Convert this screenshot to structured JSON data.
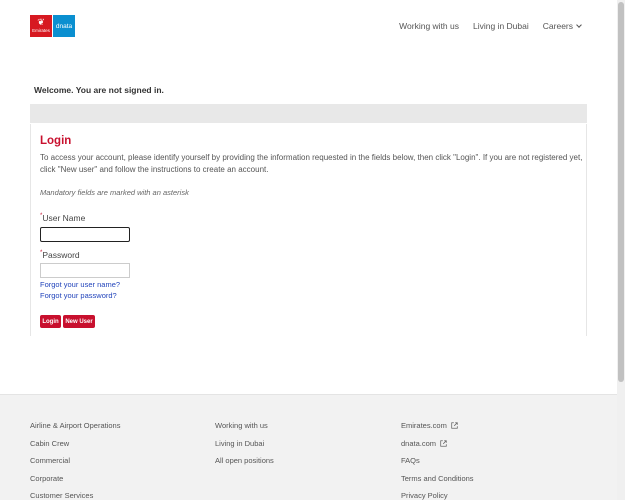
{
  "header": {
    "logo": {
      "emirates": "Emirates",
      "dnata": "dnata"
    },
    "nav": [
      "Working with us",
      "Living in Dubai",
      "Careers"
    ]
  },
  "welcome": "Welcome. You are not signed in.",
  "login": {
    "title": "Login",
    "intro": "To access your account, please identify yourself by providing the information requested in the fields below, then click \"Login\". If you are not registered yet, click \"New user\" and follow the instructions to create an account.",
    "mandatory_note": "Mandatory fields are marked with an asterisk",
    "asterisk": "*",
    "username_label": "User Name",
    "username_value": "",
    "password_label": "Password",
    "password_value": "",
    "forgot_username": "Forgot your user name?",
    "forgot_password": "Forgot your password?",
    "login_button": "Login",
    "new_user_button": "New User"
  },
  "footer": {
    "col1": [
      "Airline & Airport Operations",
      "Cabin Crew",
      "Commercial",
      "Corporate",
      "Customer Services"
    ],
    "col2": [
      "Working with us",
      "Living in Dubai",
      "All open positions"
    ],
    "col3": [
      "Emirates.com",
      "dnata.com",
      "FAQs",
      "Terms and Conditions",
      "Privacy Policy"
    ]
  },
  "colors": {
    "accent": "#c8102e",
    "emirates_red": "#d71921",
    "dnata_blue": "#0a8fd0",
    "link": "#2244bb"
  },
  "icons": {
    "external_link": "external-link-icon",
    "chevron": "chevron-down-icon"
  }
}
